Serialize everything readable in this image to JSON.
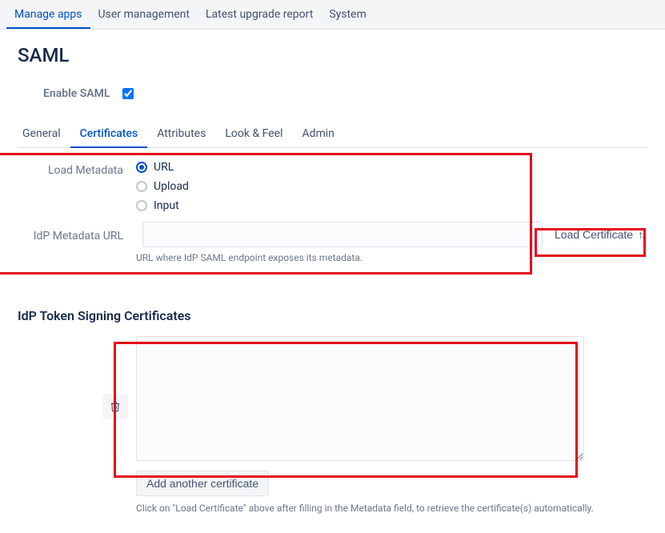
{
  "topNav": {
    "items": [
      {
        "label": "Manage apps",
        "active": true
      },
      {
        "label": "User management",
        "active": false
      },
      {
        "label": "Latest upgrade report",
        "active": false
      },
      {
        "label": "System",
        "active": false
      }
    ]
  },
  "page": {
    "title": "SAML",
    "enableLabel": "Enable SAML",
    "enableChecked": true
  },
  "subTabs": {
    "items": [
      {
        "label": "General",
        "active": false
      },
      {
        "label": "Certificates",
        "active": true
      },
      {
        "label": "Attributes",
        "active": false
      },
      {
        "label": "Look & Feel",
        "active": false
      },
      {
        "label": "Admin",
        "active": false
      }
    ]
  },
  "metadata": {
    "loadLabel": "Load Metadata",
    "options": {
      "url": "URL",
      "upload": "Upload",
      "input": "Input"
    },
    "selected": "url",
    "urlLabel": "IdP Metadata URL",
    "urlValue": "",
    "urlHelp": "URL where IdP SAML endpoint exposes its metadata.",
    "loadCertLabel": "Load Certificate"
  },
  "certs": {
    "heading": "IdP Token Signing Certificates",
    "textareaValue": "",
    "addButton": "Add another certificate",
    "help": "Click on \"Load Certificate\" above after filling in the Metadata field, to retrieve the certificate(s) automatically."
  }
}
